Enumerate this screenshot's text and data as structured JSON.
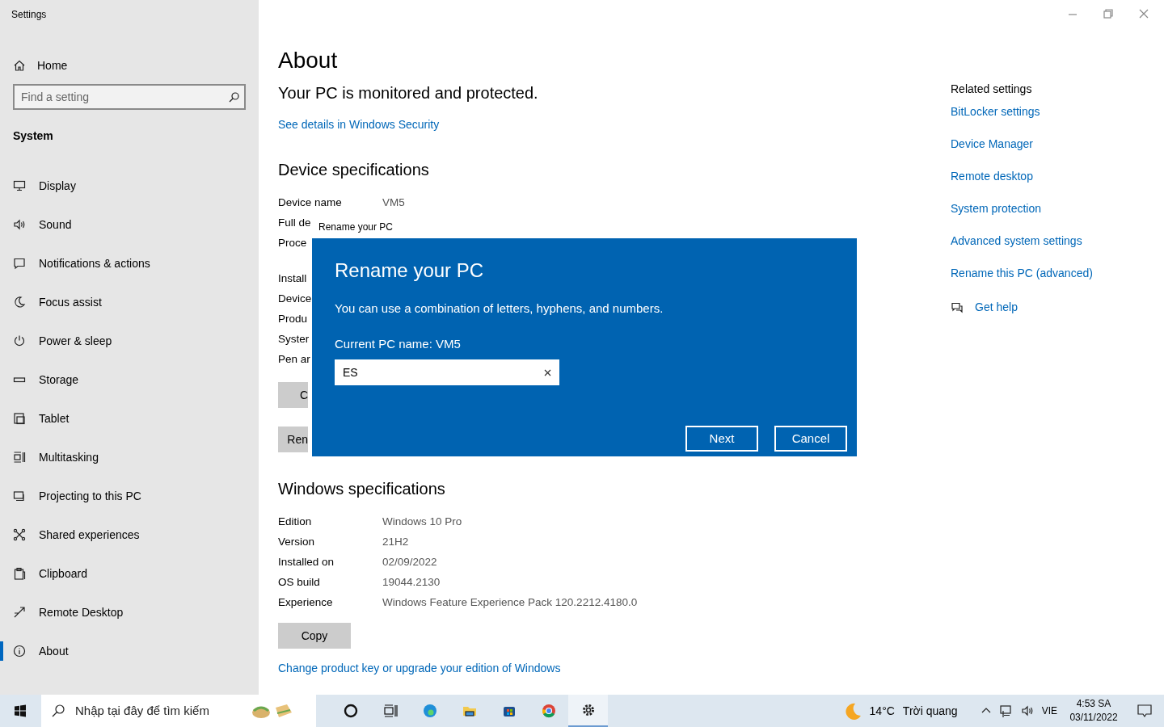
{
  "window": {
    "title": "Settings"
  },
  "sidebar": {
    "home": "Home",
    "search": {
      "placeholder": "Find a setting"
    },
    "section": "System",
    "items": [
      {
        "label": "Display",
        "selected": false
      },
      {
        "label": "Sound",
        "selected": false
      },
      {
        "label": "Notifications & actions",
        "selected": false
      },
      {
        "label": "Focus assist",
        "selected": false
      },
      {
        "label": "Power & sleep",
        "selected": false
      },
      {
        "label": "Storage",
        "selected": false
      },
      {
        "label": "Tablet",
        "selected": false
      },
      {
        "label": "Multitasking",
        "selected": false
      },
      {
        "label": "Projecting to this PC",
        "selected": false
      },
      {
        "label": "Shared experiences",
        "selected": false
      },
      {
        "label": "Clipboard",
        "selected": false
      },
      {
        "label": "Remote Desktop",
        "selected": false
      },
      {
        "label": "About",
        "selected": true
      }
    ]
  },
  "main": {
    "title": "About",
    "security": {
      "status": "Your PC is monitored and protected.",
      "link": "See details in Windows Security"
    },
    "device_specifications": {
      "heading": "Device specifications",
      "rows": [
        {
          "label": "Device name",
          "value": "VM5"
        },
        {
          "label": "Full de"
        },
        {
          "label": "Proce"
        },
        {
          "label": "Install"
        },
        {
          "label": "Device"
        },
        {
          "label": "Produ"
        },
        {
          "label": "Syster"
        },
        {
          "label": "Pen ar"
        }
      ],
      "buttons": [
        "C",
        "Ren"
      ]
    },
    "windows_specifications": {
      "heading": "Windows specifications",
      "rows": [
        {
          "label": "Edition",
          "value": "Windows 10 Pro"
        },
        {
          "label": "Version",
          "value": "21H2"
        },
        {
          "label": "Installed on",
          "value": "02/09/2022"
        },
        {
          "label": "OS build",
          "value": "19044.2130"
        },
        {
          "label": "Experience",
          "value": "Windows Feature Experience Pack 120.2212.4180.0"
        }
      ],
      "button": "Copy",
      "link": "Change product key or upgrade your edition of Windows"
    }
  },
  "related": {
    "heading": "Related settings",
    "links": [
      "BitLocker settings",
      "Device Manager",
      "Remote desktop",
      "System protection",
      "Advanced system settings",
      "Rename this PC (advanced)"
    ],
    "help": "Get help"
  },
  "dialog": {
    "title_bar": "Rename your PC",
    "heading": "Rename your PC",
    "description": "You can use a combination of letters, hyphens, and numbers.",
    "current_name": "Current PC name: VM5",
    "input": {
      "value": "ES"
    },
    "buttons": [
      "Next",
      "Cancel"
    ]
  },
  "taskbar": {
    "search": {
      "placeholder": "Nhập tại đây để tìm kiếm"
    },
    "apps": [
      {
        "selected": false
      },
      {
        "selected": false
      },
      {
        "selected": false
      },
      {
        "selected": false
      },
      {
        "selected": false
      },
      {
        "selected": false
      },
      {
        "selected": true
      }
    ],
    "weather": {
      "temperature": "14°C",
      "condition": "Trời quang"
    },
    "language": "VIE",
    "time": "4:53 SA",
    "date": "03/11/2022"
  }
}
